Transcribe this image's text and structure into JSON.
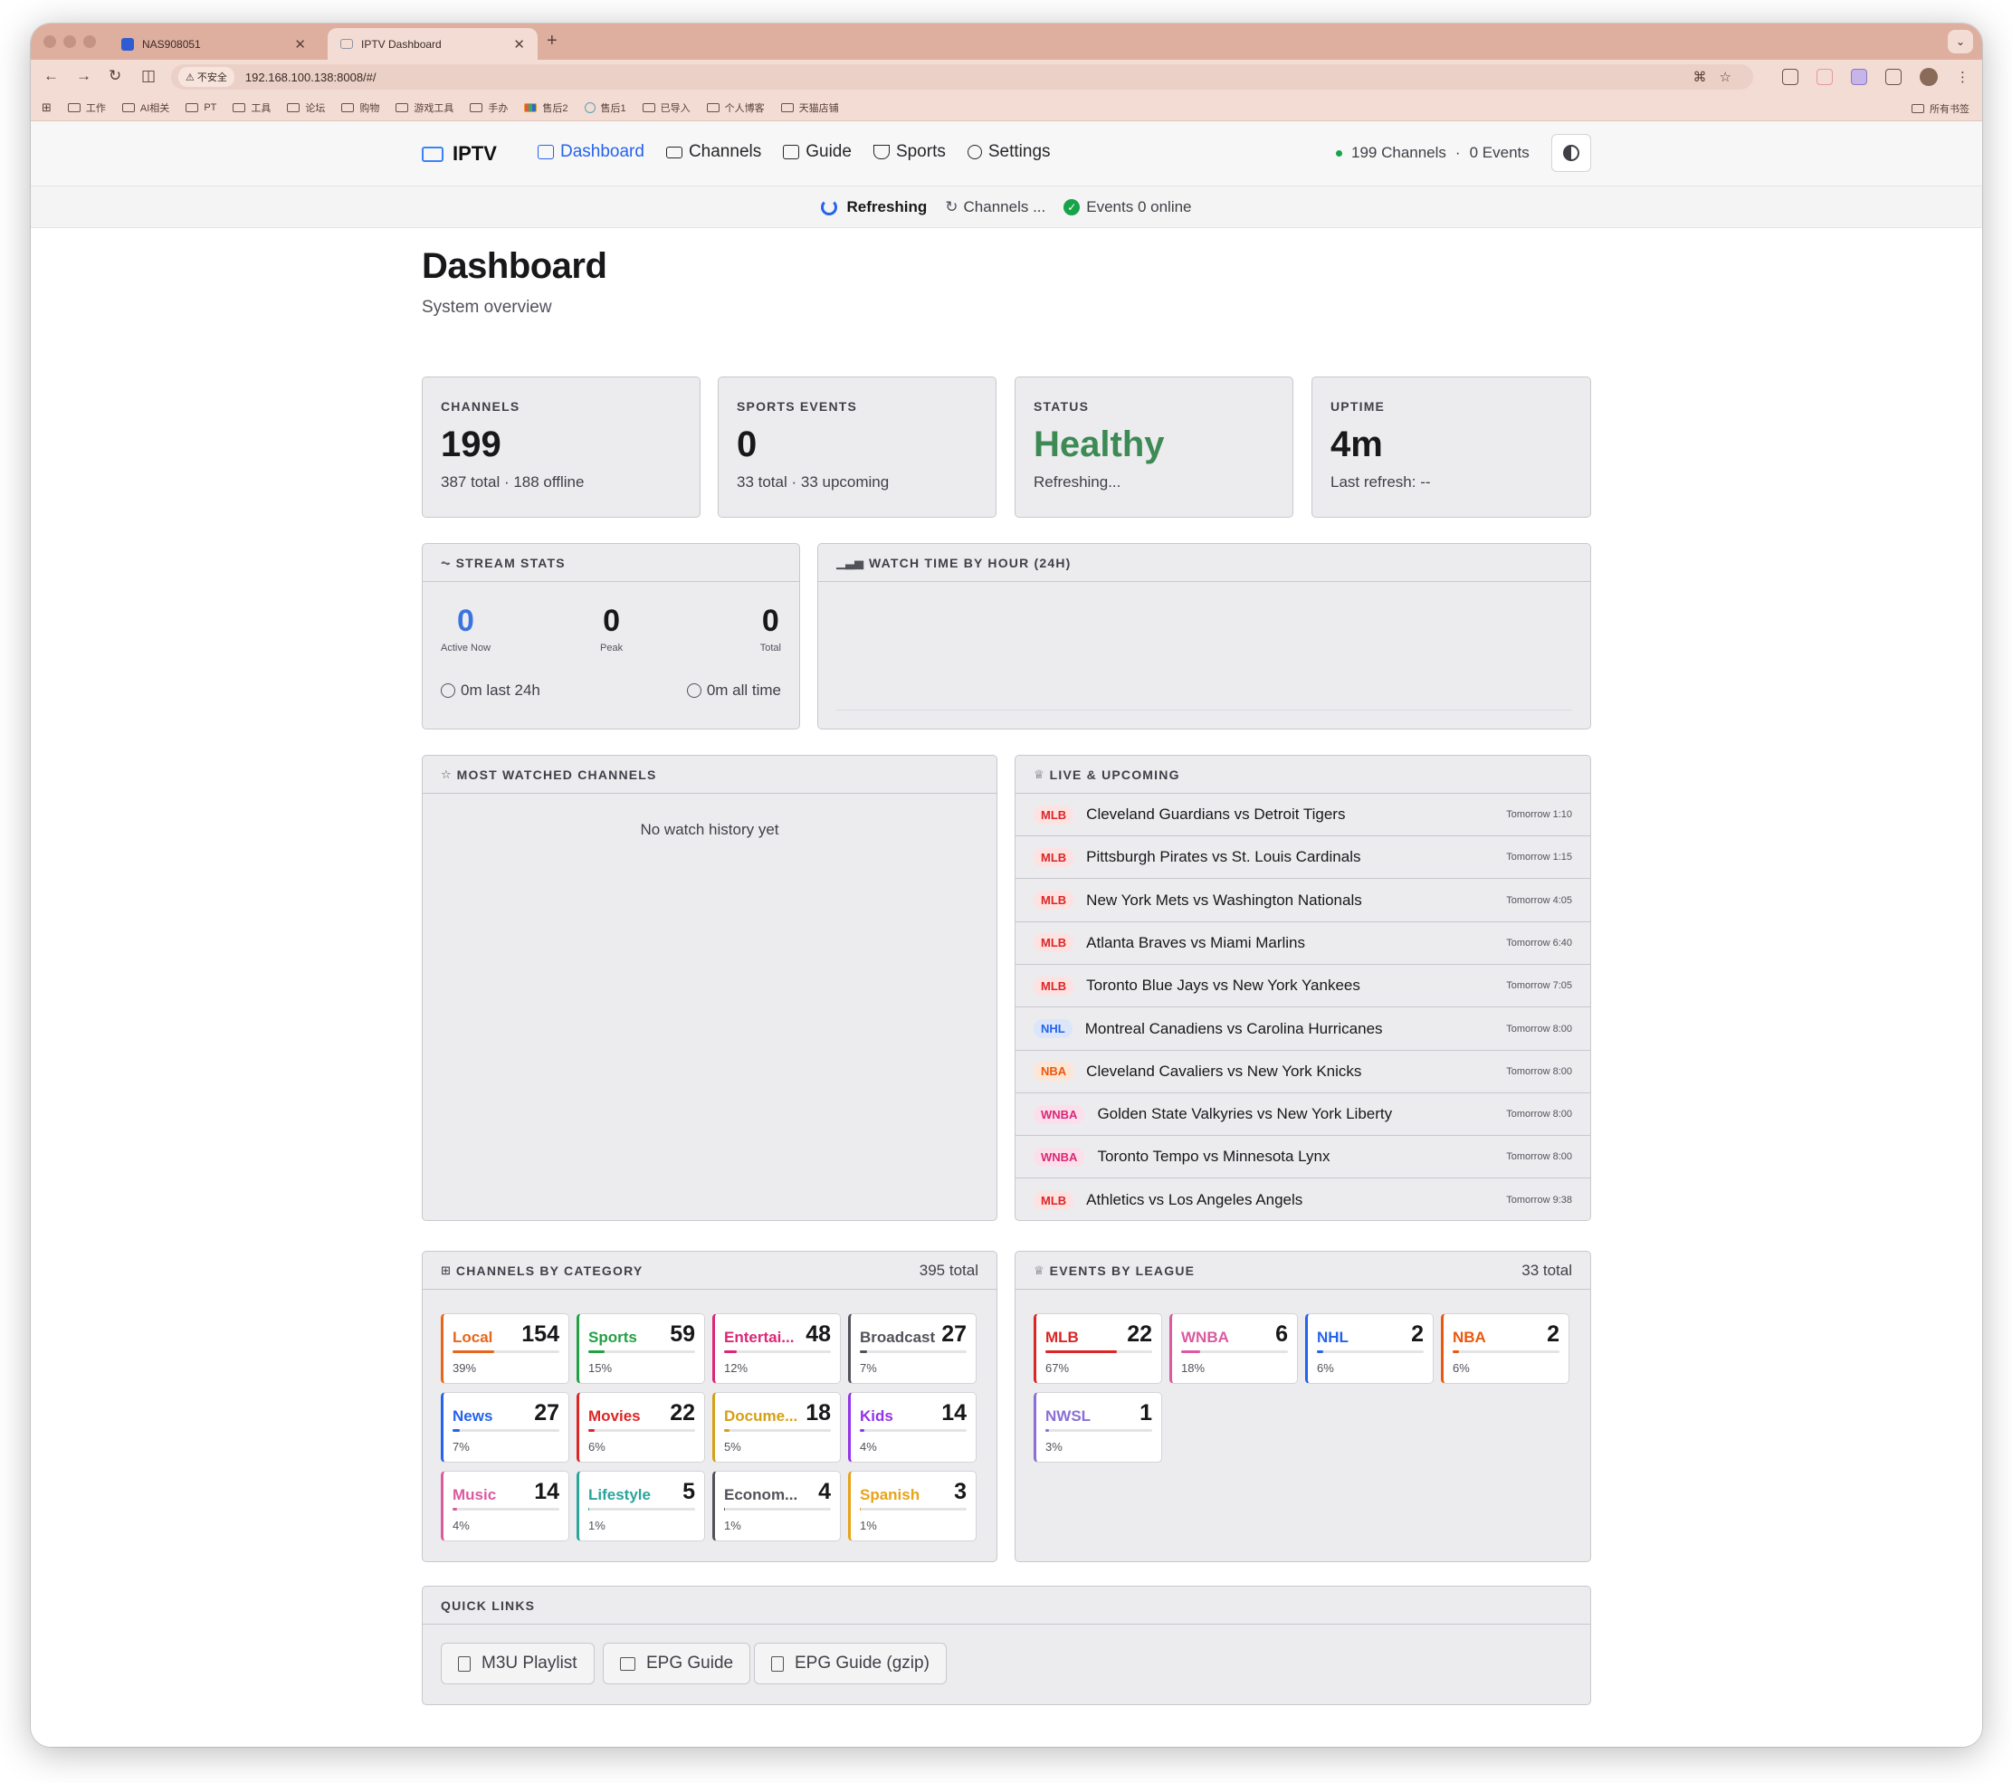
{
  "browser": {
    "tabs": [
      {
        "title": "NAS908051",
        "favicon_color": "#2f5bd3"
      },
      {
        "title": "IPTV Dashboard",
        "favicon_color": "#8b95a5"
      }
    ],
    "address": {
      "security_label": "不安全",
      "url": "192.168.100.138:8008/#/"
    },
    "bookmarks": [
      "工作",
      "AI相关",
      "PT",
      "工具",
      "论坛",
      "购物",
      "游戏工具",
      "手办",
      "售后2",
      "售后1",
      "已导入",
      "个人博客",
      "天猫店铺"
    ],
    "bookmarks_right": "所有书签"
  },
  "nav": {
    "brand": "IPTV",
    "items": [
      {
        "label": "Dashboard",
        "active": true
      },
      {
        "label": "Channels"
      },
      {
        "label": "Guide"
      },
      {
        "label": "Sports"
      },
      {
        "label": "Settings"
      }
    ],
    "status_channels": "199 Channels",
    "status_sep": "·",
    "status_events": "0 Events"
  },
  "statusbar": {
    "refreshing": "Refreshing",
    "channels": "Channels ...",
    "events": "Events 0 online"
  },
  "page": {
    "title": "Dashboard",
    "subtitle": "System overview"
  },
  "stats": [
    {
      "label": "CHANNELS",
      "value": "199",
      "sub": "387 total · 188 offline",
      "color": "#18181b"
    },
    {
      "label": "SPORTS EVENTS",
      "value": "0",
      "sub": "33 total · 33 upcoming",
      "color": "#18181b"
    },
    {
      "label": "STATUS",
      "value": "Healthy",
      "sub": "Refreshing...",
      "color": "#3d8a55"
    },
    {
      "label": "UPTIME",
      "value": "4m",
      "sub": "Last refresh: --",
      "color": "#18181b"
    }
  ],
  "stream_stats": {
    "title": "STREAM STATS",
    "active": "0",
    "active_label": "Active Now",
    "peak": "0",
    "peak_label": "Peak",
    "total": "0",
    "total_label": "Total",
    "last24": "0m last 24h",
    "alltime": "0m all time"
  },
  "watch_time": {
    "title": "WATCH TIME BY HOUR (24H)"
  },
  "most_watched": {
    "title": "MOST WATCHED CHANNELS",
    "empty": "No watch history yet"
  },
  "live": {
    "title": "LIVE & UPCOMING",
    "events": [
      {
        "league": "MLB",
        "name": "Cleveland Guardians vs Detroit Tigers",
        "time": "Tomorrow 1:10"
      },
      {
        "league": "MLB",
        "name": "Pittsburgh Pirates vs St. Louis Cardinals",
        "time": "Tomorrow 1:15"
      },
      {
        "league": "MLB",
        "name": "New York Mets vs Washington Nationals",
        "time": "Tomorrow 4:05"
      },
      {
        "league": "MLB",
        "name": "Atlanta Braves vs Miami Marlins",
        "time": "Tomorrow 6:40"
      },
      {
        "league": "MLB",
        "name": "Toronto Blue Jays vs New York Yankees",
        "time": "Tomorrow 7:05"
      },
      {
        "league": "NHL",
        "name": "Montreal Canadiens vs Carolina Hurricanes",
        "time": "Tomorrow 8:00"
      },
      {
        "league": "NBA",
        "name": "Cleveland Cavaliers vs New York Knicks",
        "time": "Tomorrow 8:00"
      },
      {
        "league": "WNBA",
        "name": "Golden State Valkyries vs New York Liberty",
        "time": "Tomorrow 8:00"
      },
      {
        "league": "WNBA",
        "name": "Toronto Tempo vs Minnesota Lynx",
        "time": "Tomorrow 8:00"
      },
      {
        "league": "MLB",
        "name": "Athletics vs Los Angeles Angels",
        "time": "Tomorrow 9:38"
      }
    ]
  },
  "league_colors": {
    "MLB": {
      "fg": "#dc2626",
      "bg": "#fde2e2"
    },
    "NHL": {
      "fg": "#2563eb",
      "bg": "#dbe6fb"
    },
    "NBA": {
      "fg": "#ea580c",
      "bg": "#fde6d6"
    },
    "WNBA": {
      "fg": "#db2777",
      "bg": "#fbe0ec"
    },
    "NWSL": {
      "fg": "#7c3aed",
      "bg": "#ede4fb"
    }
  },
  "categories": {
    "title": "CHANNELS BY CATEGORY",
    "total": "395 total",
    "items": [
      {
        "name": "Local",
        "count": "154",
        "pct": "39%",
        "frac": 0.39,
        "color": "#e8651d"
      },
      {
        "name": "Sports",
        "count": "59",
        "pct": "15%",
        "frac": 0.15,
        "color": "#22a044"
      },
      {
        "name": "Entertai...",
        "count": "48",
        "pct": "12%",
        "frac": 0.12,
        "color": "#db2777"
      },
      {
        "name": "Broadcast",
        "count": "27",
        "pct": "7%",
        "frac": 0.07,
        "color": "#52525b"
      },
      {
        "name": "News",
        "count": "27",
        "pct": "7%",
        "frac": 0.07,
        "color": "#2563eb"
      },
      {
        "name": "Movies",
        "count": "22",
        "pct": "6%",
        "frac": 0.06,
        "color": "#dc2626"
      },
      {
        "name": "Docume...",
        "count": "18",
        "pct": "5%",
        "frac": 0.05,
        "color": "#d4a017"
      },
      {
        "name": "Kids",
        "count": "14",
        "pct": "4%",
        "frac": 0.04,
        "color": "#9333ea"
      },
      {
        "name": "Music",
        "count": "14",
        "pct": "4%",
        "frac": 0.04,
        "color": "#db5aa0"
      },
      {
        "name": "Lifestyle",
        "count": "5",
        "pct": "1%",
        "frac": 0.01,
        "color": "#2aa59b"
      },
      {
        "name": "Econom...",
        "count": "4",
        "pct": "1%",
        "frac": 0.01,
        "color": "#52525b"
      },
      {
        "name": "Spanish",
        "count": "3",
        "pct": "1%",
        "frac": 0.01,
        "color": "#e8a317"
      }
    ]
  },
  "leagues": {
    "title": "EVENTS BY LEAGUE",
    "total": "33 total",
    "items": [
      {
        "name": "MLB",
        "count": "22",
        "pct": "67%",
        "frac": 0.67,
        "color": "#dc2626"
      },
      {
        "name": "WNBA",
        "count": "6",
        "pct": "18%",
        "frac": 0.18,
        "color": "#db5aa0"
      },
      {
        "name": "NHL",
        "count": "2",
        "pct": "6%",
        "frac": 0.06,
        "color": "#2563eb"
      },
      {
        "name": "NBA",
        "count": "2",
        "pct": "6%",
        "frac": 0.06,
        "color": "#ea580c"
      },
      {
        "name": "NWSL",
        "count": "1",
        "pct": "3%",
        "frac": 0.03,
        "color": "#8b6fd6"
      }
    ]
  },
  "quick_links": {
    "title": "QUICK LINKS",
    "items": [
      "M3U Playlist",
      "EPG Guide",
      "EPG Guide (gzip)"
    ]
  }
}
